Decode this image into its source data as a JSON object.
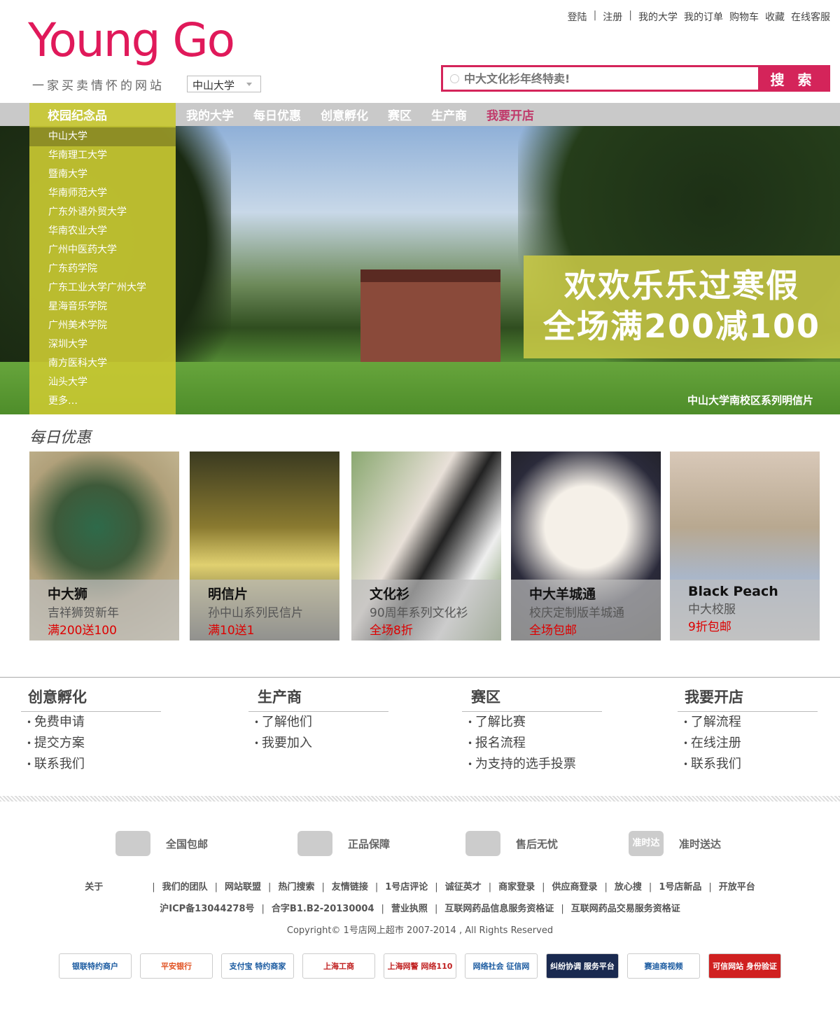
{
  "top_links": [
    "登陆",
    "注册",
    "我的大学",
    "我的订单",
    "购物车",
    "收藏",
    "在线客服"
  ],
  "logo": "Young Go",
  "slogan": "一家买卖情怀的网站",
  "campus_select": "中山大学",
  "search": {
    "placeholder": "中大文化衫年终特卖!",
    "button": "搜 索"
  },
  "nav": {
    "category": "校园纪念品",
    "items": [
      "我的大学",
      "每日优惠",
      "创意孵化",
      "赛区",
      "生产商",
      "我要开店"
    ]
  },
  "sidebar": [
    "中山大学",
    "华南理工大学",
    "暨南大学",
    "华南师范大学",
    "广东外语外贸大学",
    "华南农业大学",
    "广州中医药大学",
    "广东药学院",
    "广东工业大学广州大学",
    "星海音乐学院",
    "广州美术学院",
    "深圳大学",
    "南方医科大学",
    "汕头大学",
    "更多…"
  ],
  "banner": {
    "line1": "欢欢乐乐过寒假",
    "line2": "全场满200减100",
    "caption": "中山大学南校区系列明信片"
  },
  "daily": {
    "title": "每日优惠",
    "cards": [
      {
        "name": "中大狮",
        "desc": "吉祥狮贺新年",
        "promo": "满200送100"
      },
      {
        "name": "明信片",
        "desc": "孙中山系列民信片",
        "promo": "满10送1"
      },
      {
        "name": "文化衫",
        "desc": "90周年系列文化衫",
        "promo": "全场8折"
      },
      {
        "name": "中大羊城通",
        "desc": "校庆定制版羊城通",
        "promo": "全场包邮"
      },
      {
        "name": "Black Peach",
        "desc": "中大校服",
        "promo": "9折包邮"
      }
    ]
  },
  "columns": [
    {
      "title": "创意孵化",
      "items": [
        "免费申请",
        "提交方案",
        "联系我们"
      ]
    },
    {
      "title": "生产商",
      "items": [
        "了解他们",
        "我要加入"
      ]
    },
    {
      "title": "赛区",
      "items": [
        "了解比赛",
        "报名流程",
        "为支持的选手投票"
      ]
    },
    {
      "title": "我要开店",
      "items": [
        "了解流程",
        "在线注册",
        "联系我们"
      ]
    }
  ],
  "features": [
    {
      "icon": "truck-icon",
      "label": "全国包邮"
    },
    {
      "icon": "shield-icon",
      "label": "正品保障"
    },
    {
      "icon": "handshake-icon",
      "label": "售后无忧"
    },
    {
      "icon": "clock-icon",
      "label": "准时送达",
      "mark": "准时达"
    }
  ],
  "footer_links": [
    "关于",
    "我们的团队",
    "网站联盟",
    "热门搜索",
    "友情链接",
    "1号店评论",
    "诚征英才",
    "商家登录",
    "供应商登录",
    "放心搜",
    "1号店新品",
    "开放平台"
  ],
  "license_links": [
    "沪ICP备13044278号",
    "合字B1.B2-20130004",
    "营业执照",
    "互联网药品信息服务资格证",
    "互联网药品交易服务资格证"
  ],
  "copyright": "Copyright© 1号店网上超市 2007-2014 , All Rights Reserved",
  "badges": [
    "银联特约商户",
    "平安银行",
    "支付宝 特约商家",
    "上海工商",
    "上海网警 网络110",
    "网络社会 征信网",
    "纠纷协调 服务平台",
    "赛迪商视频",
    "可信网站 身份验证"
  ],
  "colors": {
    "accent": "#d4245a",
    "olive": "#c8c83e",
    "nav_bg": "#c9c9c9"
  }
}
